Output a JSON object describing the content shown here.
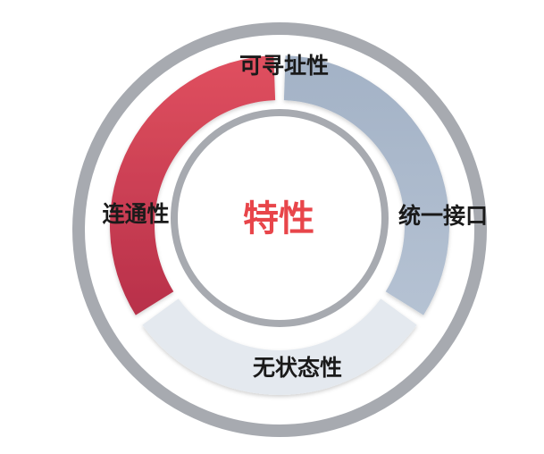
{
  "center": {
    "label": "特性",
    "color": "#e8454a"
  },
  "segments": [
    {
      "id": "addressability",
      "label": "可寻址性",
      "color_start": "#a3b2c6",
      "color_end": "#8d9db4"
    },
    {
      "id": "uniform-interface",
      "label": "统一接口",
      "color_start": "#9aabc1",
      "color_end": "#b5c2d3"
    },
    {
      "id": "statelessness",
      "label": "无状态性",
      "color_start": "#e4e9ef",
      "color_end": "#e4e9ef"
    },
    {
      "id": "connectedness",
      "label": "连通性",
      "color_start": "#e0505f",
      "color_end": "#b8304a"
    }
  ],
  "rings": {
    "outer_color": "#a7aab0",
    "inner_color": "#a7aab0"
  }
}
